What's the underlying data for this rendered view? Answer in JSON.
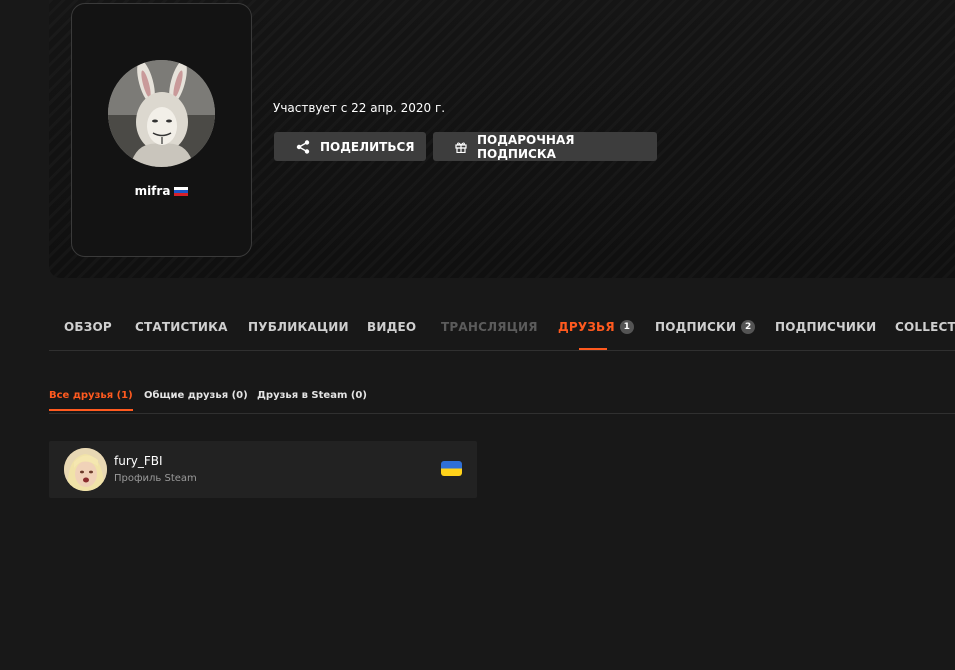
{
  "profile": {
    "username": "mifra",
    "country_flag": "flag-ru",
    "member_since": "Участвует с 22 апр. 2020 г."
  },
  "actions": {
    "share_label": "ПОДЕЛИТЬСЯ",
    "gift_label": "ПОДАРОЧНАЯ ПОДПИСКА"
  },
  "tabs": [
    {
      "label": "ОБЗОР",
      "badge": ""
    },
    {
      "label": "СТАТИСТИКА",
      "badge": ""
    },
    {
      "label": "ПУБЛИКАЦИИ",
      "badge": ""
    },
    {
      "label": "ВИДЕО",
      "badge": ""
    },
    {
      "label": "ТРАНСЛЯЦИЯ",
      "badge": ""
    },
    {
      "label": "ДРУЗЬЯ",
      "badge": "1"
    },
    {
      "label": "ПОДПИСКИ",
      "badge": "2"
    },
    {
      "label": "ПОДПИСЧИКИ",
      "badge": ""
    },
    {
      "label": "COLLECTI",
      "badge": ""
    }
  ],
  "active_tab": "ДРУЗЬЯ",
  "subtabs": [
    {
      "label": "Все друзья (1)"
    },
    {
      "label": "Общие друзья (0)"
    },
    {
      "label": "Друзья в Steam (0)"
    }
  ],
  "friends": [
    {
      "name": "fury_FBI",
      "subtitle": "Профиль Steam",
      "country_flag": "flag-ua"
    }
  ],
  "colors": {
    "accent": "#ff5a1f",
    "background": "#181818",
    "button": "#3d3d3d",
    "card": "#222222"
  }
}
